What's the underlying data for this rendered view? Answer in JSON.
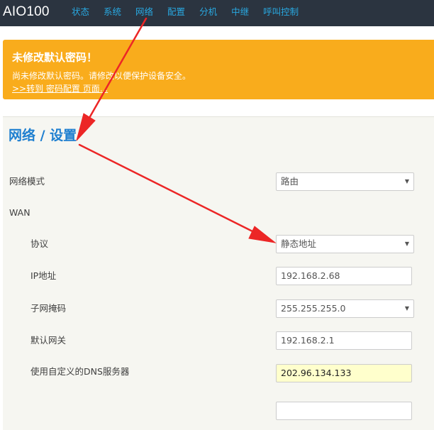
{
  "brand": "AIO100",
  "nav": [
    "状态",
    "系统",
    "网络",
    "配置",
    "分机",
    "中继",
    "呼叫控制"
  ],
  "alert": {
    "title": "未修改默认密码！",
    "text": "尚未修改默认密码。请修改以便保护设备安全。",
    "link": ">>转到 密码配置 页面..."
  },
  "page_title": "网络 / 设置",
  "form": {
    "network_mode_label": "网络模式",
    "network_mode_value": "路由",
    "wan_label": "WAN",
    "protocol_label": "协议",
    "protocol_value": "静态地址",
    "ip_label": "IP地址",
    "ip_value": "192.168.2.68",
    "netmask_label": "子网掩码",
    "netmask_value": "255.255.255.0",
    "gateway_label": "默认网关",
    "gateway_value": "192.168.2.1",
    "dns_label": "使用自定义的DNS服务器",
    "dns_value": "202.96.134.133",
    "dns_value_2": ""
  },
  "icons": {
    "select_caret": "triangle-down-icon",
    "annotation": "red-arrow"
  },
  "colors": {
    "topbar": "#2b3440",
    "nav_link": "#29a8e0",
    "alert": "#f9ac1c",
    "title": "#1e7fd0",
    "annotation": "#ec2626",
    "dns_highlight": "#ffffcc"
  }
}
